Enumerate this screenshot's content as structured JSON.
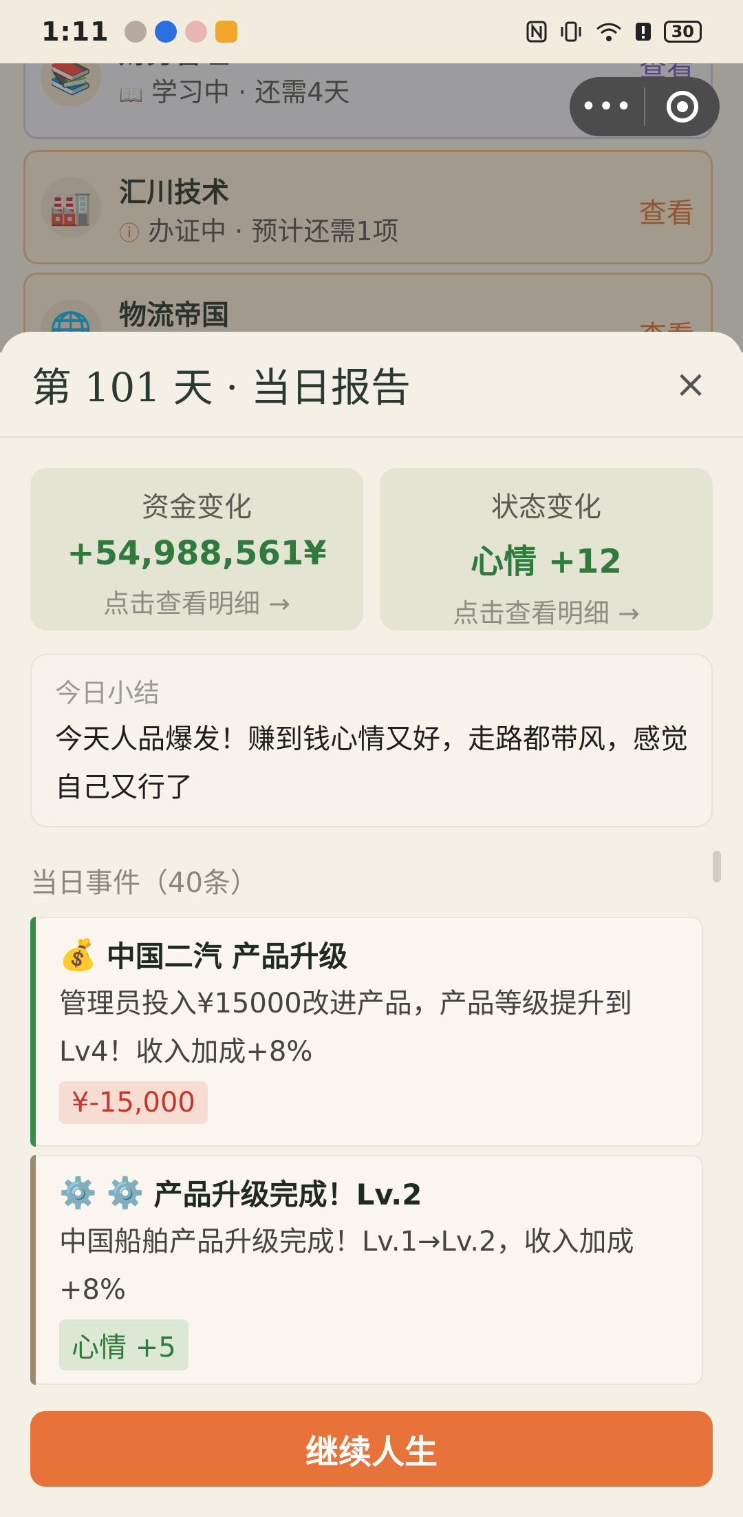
{
  "status_bar": {
    "time": "1:11",
    "battery": "30"
  },
  "background_list": {
    "items": [
      {
        "title": "财务管理",
        "status_icon": "book-icon",
        "subtitle": "学习中 · 还需4天",
        "action": "查看"
      },
      {
        "title": "汇川技术",
        "status_icon": "alert-icon",
        "subtitle": "办证中 · 预计还需1项",
        "action": "查看"
      },
      {
        "title": "物流帝国",
        "action": "查看"
      }
    ]
  },
  "capsule": {
    "more": "•••"
  },
  "report": {
    "title": "第 101 天 · 当日报告",
    "close": "×",
    "money_change": {
      "label": "资金变化",
      "value": "+54,988,561¥",
      "link": "点击查看明细 →"
    },
    "status_change": {
      "label": "状态变化",
      "value": "心情 +12",
      "link": "点击查看明细 →"
    },
    "summary": {
      "label": "今日小结",
      "text": "今天人品爆发！赚到钱心情又好，走路都带风，感觉自己又行了"
    },
    "events_title": "当日事件（40条）",
    "events": [
      {
        "icon": "💰",
        "title": "中国二汽 产品升级",
        "desc": "管理员投入¥15000改进产品，产品等级提升到Lv4！收入加成+8%",
        "tag": "¥-15,000"
      },
      {
        "icon": "⚙️ ⚙️",
        "title": "产品升级完成！Lv.2",
        "desc": "中国船舶产品升级完成！Lv.1→Lv.2，收入加成+8%",
        "tag": "心情 +5"
      }
    ],
    "continue_button": "继续人生"
  },
  "colors": {
    "accent_orange": "#e8733a",
    "positive_green": "#2f7a3c",
    "negative_red": "#c0392b"
  }
}
